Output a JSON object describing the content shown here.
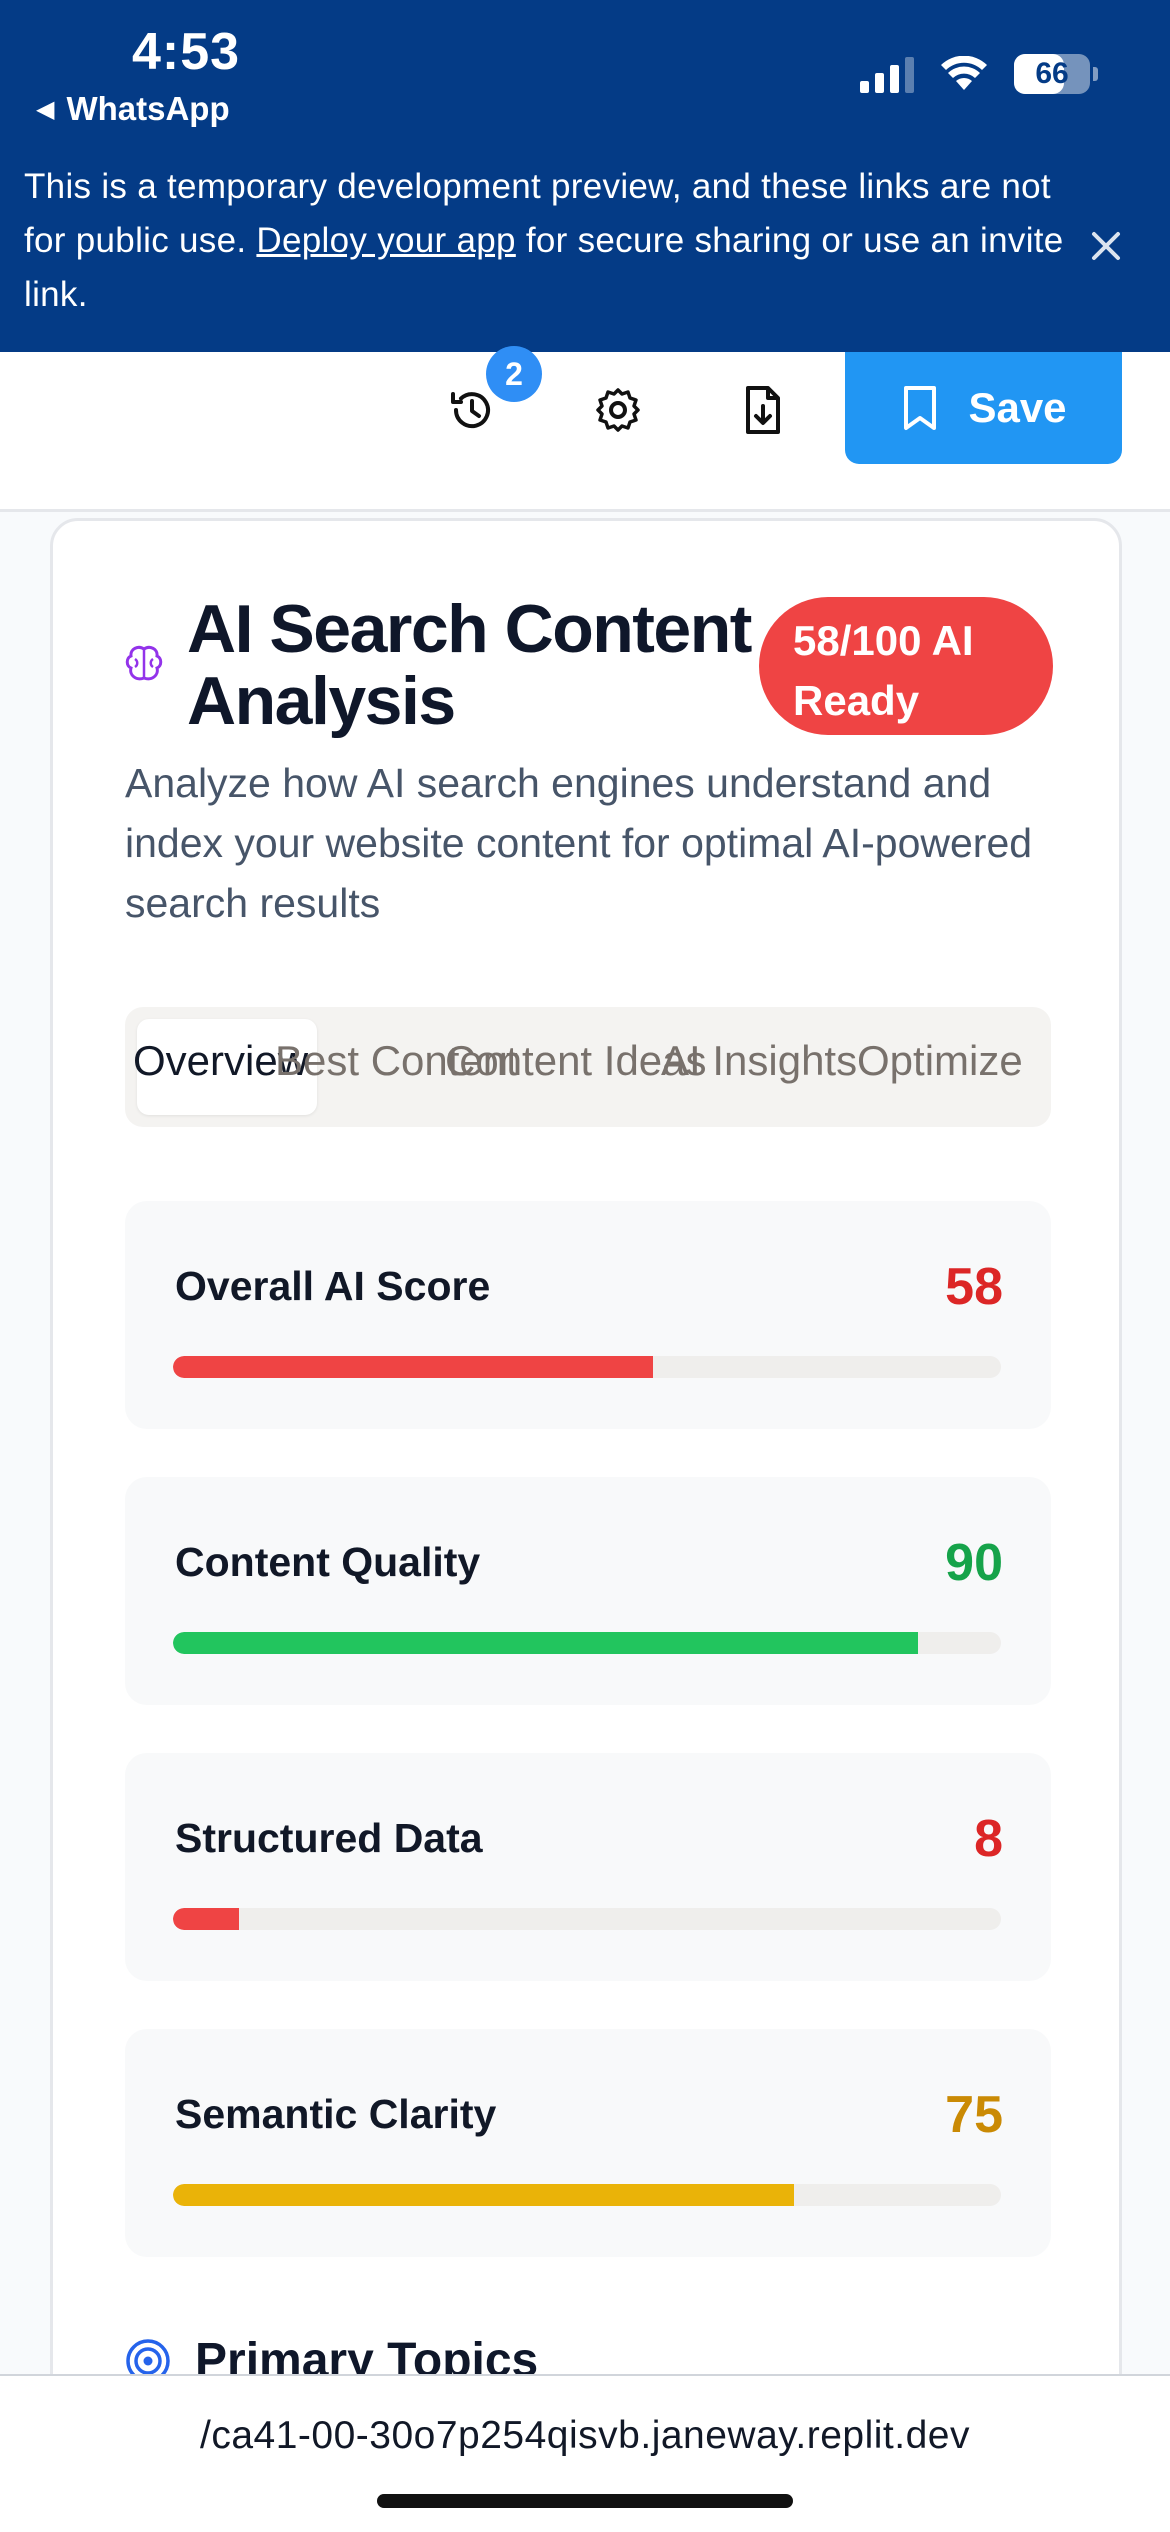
{
  "status_bar": {
    "time": "4:53",
    "back_app": "WhatsApp",
    "battery": "66"
  },
  "banner": {
    "text_before": "This is a temporary development preview, and these links are not for public use. ",
    "link_text": "Deploy your app",
    "text_after": " for secure sharing or use an invite link."
  },
  "toolbar": {
    "history_badge": "2",
    "save_label": "Save"
  },
  "card": {
    "title": "AI Search Content Analysis",
    "badge": "58/100 AI Ready",
    "description": "Analyze how AI search engines understand and index your website content for optimal AI-powered search results"
  },
  "tabs": [
    {
      "label": "Overview",
      "active": true
    },
    {
      "label": "Best Content",
      "active": false
    },
    {
      "label": "Content Ideas",
      "active": false
    },
    {
      "label": "AI Insights",
      "active": false
    },
    {
      "label": "Optimize",
      "active": false
    }
  ],
  "metrics": [
    {
      "label": "Overall AI Score",
      "value": "58",
      "fraction": 0.58,
      "color": "#ef4444",
      "text_color": "#dc2626"
    },
    {
      "label": "Content Quality",
      "value": "90",
      "fraction": 0.9,
      "color": "#22c55e",
      "text_color": "#16a34a"
    },
    {
      "label": "Structured Data",
      "value": "8",
      "fraction": 0.08,
      "color": "#ef4444",
      "text_color": "#dc2626"
    },
    {
      "label": "Semantic Clarity",
      "value": "75",
      "fraction": 0.75,
      "color": "#eab308",
      "text_color": "#ca8a04"
    }
  ],
  "topics": {
    "title": "Primary Topics"
  },
  "browser": {
    "url": "/ca41-00-30o7p254qisvb.janeway.replit.dev"
  },
  "colors": {
    "banner_bg": "#043b86",
    "accent_blue": "#2196f3",
    "badge_red": "#ef4444"
  }
}
